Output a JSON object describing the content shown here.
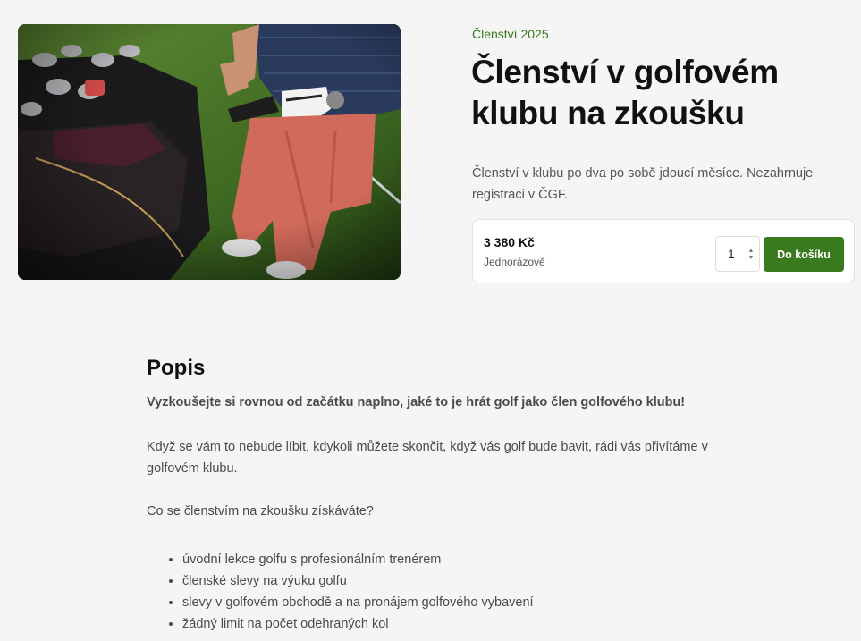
{
  "product": {
    "kicker": "Členství 2025",
    "title": "Členství v golfovém klubu na zkoušku",
    "description": "Členství v klubu po dva po sobě jdoucí měsíce. Nezahrnuje registraci v ČGF.",
    "image_alt": "Golfista s holí vedle golfového bagu"
  },
  "purchase": {
    "price": "3 380 Kč",
    "price_note": "Jednorázově",
    "quantity": "1",
    "add_to_cart_label": "Do košíku"
  },
  "details": {
    "heading": "Popis",
    "lead": "Vyzkoušejte si rovnou od začátku naplno, jaké to je hrát golf jako člen golfového klubu!",
    "paragraph_1": "Když se vám to nebude líbit, kdykoli můžete skončit, když vás golf bude bavit, rádi vás přivítáme v golfovém klubu.",
    "paragraph_2": "Co se členstvím na zkoušku získáváte?",
    "benefits": [
      "úvodní lekce golfu s profesionálním trenérem",
      "členské slevy na výuku golfu",
      "slevy v golfovém obchodě a na pronájem golfového vybavení",
      "žádný limit na počet odehraných kol"
    ]
  },
  "colors": {
    "accent": "#3a7a1e",
    "background": "#f5f5f5",
    "text": "#111111",
    "muted": "#4a4a4a"
  }
}
